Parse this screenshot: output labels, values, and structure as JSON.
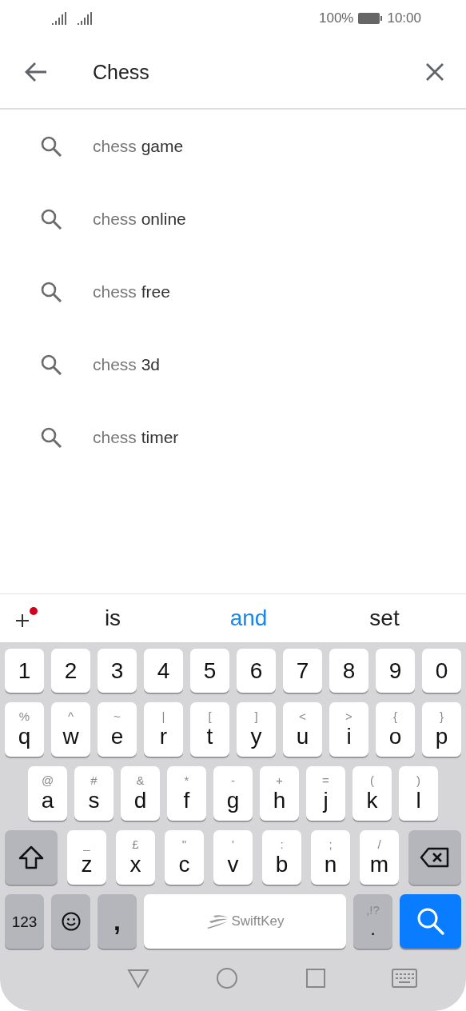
{
  "status_bar": {
    "battery": "100%",
    "time": "10:00"
  },
  "search_bar": {
    "value": "Chess"
  },
  "suggestions": [
    {
      "typed": "chess",
      "completion": " game"
    },
    {
      "typed": "chess",
      "completion": " online"
    },
    {
      "typed": "chess",
      "completion": " free"
    },
    {
      "typed": "chess",
      "completion": " 3d"
    },
    {
      "typed": "chess",
      "completion": " timer"
    }
  ],
  "predictions": [
    {
      "word": "is",
      "selected": false
    },
    {
      "word": "and",
      "selected": true
    },
    {
      "word": "set",
      "selected": false
    }
  ],
  "keyboard": {
    "rows": [
      {
        "keys": [
          {
            "kind": "char",
            "label": "1"
          },
          {
            "kind": "char",
            "label": "2"
          },
          {
            "kind": "char",
            "label": "3"
          },
          {
            "kind": "char",
            "label": "4"
          },
          {
            "kind": "char",
            "label": "5"
          },
          {
            "kind": "char",
            "label": "6"
          },
          {
            "kind": "char",
            "label": "7"
          },
          {
            "kind": "char",
            "label": "8"
          },
          {
            "kind": "char",
            "label": "9"
          },
          {
            "kind": "char",
            "label": "0"
          }
        ]
      },
      {
        "keys": [
          {
            "kind": "char",
            "label": "q",
            "hint": "%"
          },
          {
            "kind": "char",
            "label": "w",
            "hint": "^"
          },
          {
            "kind": "char",
            "label": "e",
            "hint": "~"
          },
          {
            "kind": "char",
            "label": "r",
            "hint": "|"
          },
          {
            "kind": "char",
            "label": "t",
            "hint": "["
          },
          {
            "kind": "char",
            "label": "y",
            "hint": "]"
          },
          {
            "kind": "char",
            "label": "u",
            "hint": "<"
          },
          {
            "kind": "char",
            "label": "i",
            "hint": ">"
          },
          {
            "kind": "char",
            "label": "o",
            "hint": "{"
          },
          {
            "kind": "char",
            "label": "p",
            "hint": "}"
          }
        ]
      },
      {
        "keys": [
          {
            "kind": "char",
            "label": "a",
            "hint": "@"
          },
          {
            "kind": "char",
            "label": "s",
            "hint": "#"
          },
          {
            "kind": "char",
            "label": "d",
            "hint": "&"
          },
          {
            "kind": "char",
            "label": "f",
            "hint": "*"
          },
          {
            "kind": "char",
            "label": "g",
            "hint": "-"
          },
          {
            "kind": "char",
            "label": "h",
            "hint": "+"
          },
          {
            "kind": "char",
            "label": "j",
            "hint": "="
          },
          {
            "kind": "char",
            "label": "k",
            "hint": "("
          },
          {
            "kind": "char",
            "label": "l",
            "hint": ")"
          }
        ]
      },
      {
        "keys": [
          {
            "kind": "shift"
          },
          {
            "kind": "char",
            "label": "z",
            "hint": "_"
          },
          {
            "kind": "char",
            "label": "x",
            "hint": "£"
          },
          {
            "kind": "char",
            "label": "c",
            "hint": "\""
          },
          {
            "kind": "char",
            "label": "v",
            "hint": "'"
          },
          {
            "kind": "char",
            "label": "b",
            "hint": ":"
          },
          {
            "kind": "char",
            "label": "n",
            "hint": ";"
          },
          {
            "kind": "char",
            "label": "m",
            "hint": "/"
          },
          {
            "kind": "backspace"
          }
        ]
      },
      {
        "keys": [
          {
            "kind": "mode",
            "label": "123"
          },
          {
            "kind": "emoji"
          },
          {
            "kind": "comma",
            "label": ","
          },
          {
            "kind": "space",
            "label": "SwiftKey"
          },
          {
            "kind": "punct",
            "label": ".",
            "hint": ",!?"
          },
          {
            "kind": "search"
          }
        ]
      }
    ]
  }
}
